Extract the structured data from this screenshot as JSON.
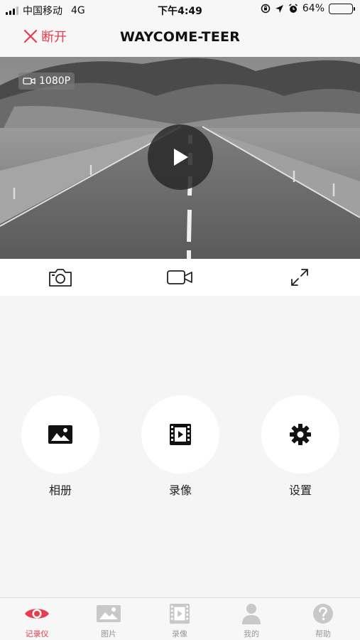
{
  "status_bar": {
    "carrier": "中国移动",
    "network": "4G",
    "time": "下午4:49",
    "battery_percent": "64%",
    "battery_level": 0.64
  },
  "nav": {
    "disconnect_label": "断开",
    "title": "WAYCOME-TEER"
  },
  "video": {
    "resolution": "1080P"
  },
  "features": [
    {
      "label": "相册",
      "icon": "image-icon"
    },
    {
      "label": "录像",
      "icon": "film-icon"
    },
    {
      "label": "设置",
      "icon": "gear-icon"
    }
  ],
  "tabs": [
    {
      "label": "记录仪",
      "icon": "eye-icon",
      "active": true
    },
    {
      "label": "图片",
      "icon": "image-icon",
      "active": false
    },
    {
      "label": "录像",
      "icon": "film-icon",
      "active": false
    },
    {
      "label": "我的",
      "icon": "person-icon",
      "active": false
    },
    {
      "label": "帮助",
      "icon": "help-icon",
      "active": false
    }
  ],
  "colors": {
    "accent": "#e83b4f",
    "battery": "#4cd964",
    "inactive_tab": "#c8c8c8"
  }
}
